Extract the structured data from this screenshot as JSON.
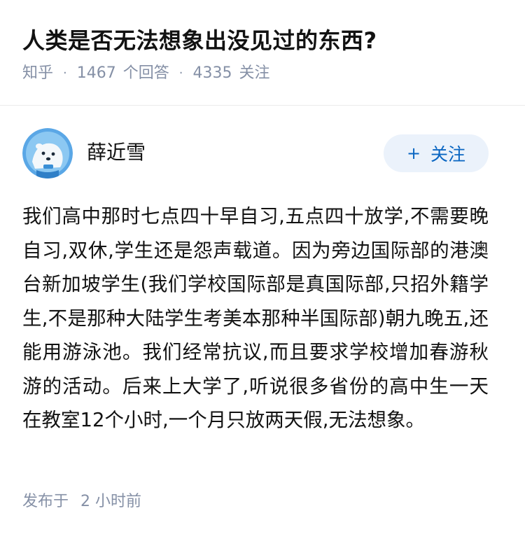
{
  "question": {
    "title": "人类是否无法想象出没见过的东西?",
    "source": "知乎",
    "separator": "·",
    "answer_count": "1467",
    "answer_label": "个回答",
    "follower_count": "4335",
    "follower_label": "关注"
  },
  "answer": {
    "author_name": "薛近雪",
    "avatar_icon": "polar-bear-avatar-icon",
    "follow_label": "关注",
    "follow_icon": "+",
    "content": "我们高中那时七点四十早自习,五点四十放学,不需要晚自习,双休,学生还是怨声载道。因为旁边国际部的港澳台新加坡学生(我们学校国际部是真国际部,只招外籍学生,不是那种大陆学生考美本那种半国际部)朝九晚五,还能用游泳池。我们经常抗议,而且要求学校增加春游秋游的活动。后来上大学了,听说很多省份的高中生一天在教室12个小时,一个月只放两天假,无法想象。",
    "published_label": "发布于",
    "published_time": "2 小时前"
  },
  "colors": {
    "meta_text": "#8590a6",
    "accent": "#0a66c2",
    "follow_bg": "#ebf2fb",
    "avatar_bg": "#5aa7e6"
  }
}
